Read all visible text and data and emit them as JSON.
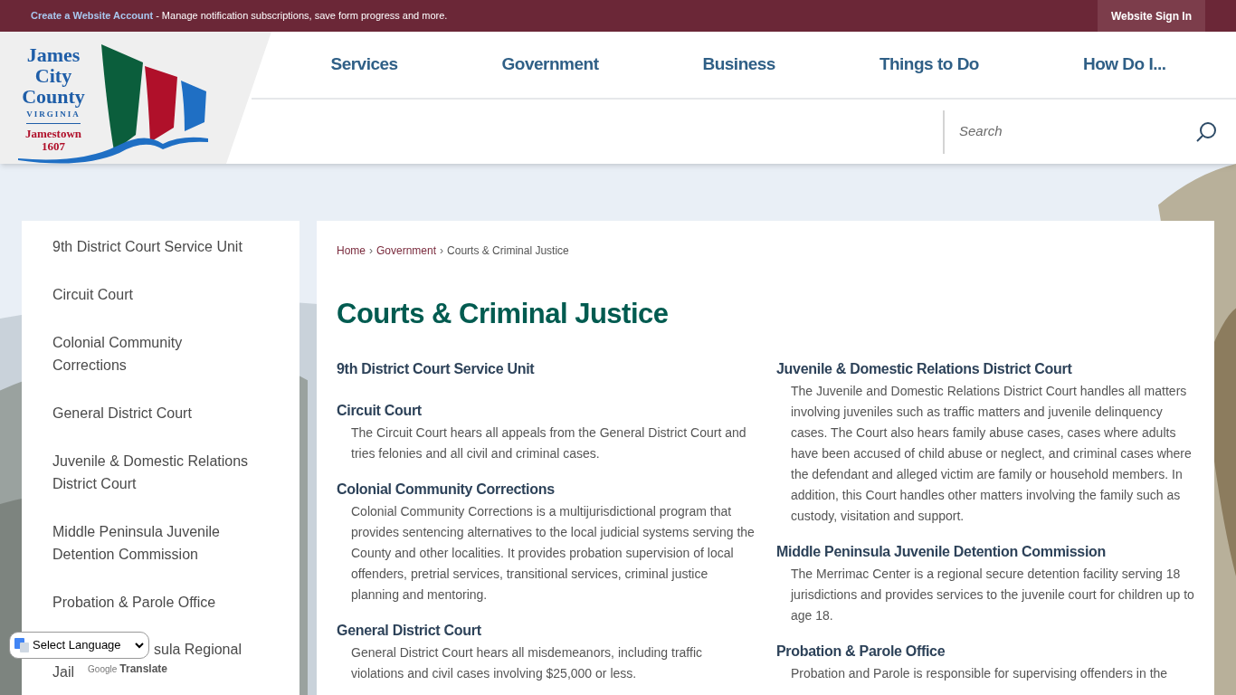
{
  "top_bar": {
    "link": "Create a Website Account",
    "message": " - Manage notification subscriptions, save form progress and more.",
    "sign_in": "Website Sign In"
  },
  "logo": {
    "line_1": "James",
    "line_2": "City",
    "line_3": "County",
    "state": "VIRGINIA",
    "town": "Jamestown",
    "year": "1607"
  },
  "nav": [
    "Services",
    "Government",
    "Business",
    "Things to Do",
    "How Do I..."
  ],
  "search": {
    "placeholder": "Search"
  },
  "sidebar": {
    "items": [
      "9th District Court Service Unit",
      "Circuit Court",
      "Colonial Community Corrections",
      "General District Court",
      "Juvenile & Domestic Relations District Court",
      "Middle Peninsula Juvenile Detention Commission",
      "Probation & Parole Office"
    ],
    "partial_item": {
      "line_1": "sula Regional",
      "line_2": "Jail"
    }
  },
  "breadcrumb": [
    {
      "label": "Home",
      "link": true
    },
    {
      "label": "Government",
      "link": true
    },
    {
      "label": "Courts & Criminal Justice",
      "link": false
    }
  ],
  "separator": "›",
  "title": "Courts & Criminal Justice",
  "columns": [
    [
      {
        "heading": "9th District Court Service Unit"
      },
      {
        "heading": "Circuit Court",
        "text": "The Circuit Court hears all appeals from the General District Court and tries felonies and all civil and criminal cases."
      },
      {
        "heading": "Colonial Community Corrections",
        "text": "Colonial Community Corrections is a multijurisdictional program that provides sentencing alternatives to the local judicial systems serving the County and other localities. It provides probation supervision of local offenders, pretrial services, transitional services, criminal justice planning and mentoring."
      },
      {
        "heading": "General District Court",
        "text": "General District Court hears all misdemeanors, including traffic violations and civil cases involving $25,000 or less."
      }
    ],
    [
      {
        "heading": "Juvenile & Domestic Relations District Court",
        "text": "The Juvenile and Domestic Relations District Court handles all matters involving juveniles such as traffic matters and juvenile delinquency cases. The Court also hears family abuse cases, cases where adults have been accused of child abuse or neglect, and criminal cases where the defendant and alleged victim are family or household members. In addition, this Court handles other matters involving the family such as custody, visitation and support."
      },
      {
        "heading": "Middle Peninsula Juvenile Detention Commission",
        "text": "The Merrimac Center is a regional secure detention facility serving 18 jurisdictions and provides services to the juvenile court for children up to age 18."
      },
      {
        "heading": "Probation & Parole Office",
        "text": "Probation and Parole is responsible for supervising offenders in the"
      }
    ]
  ],
  "translate": {
    "select": "Select Language",
    "brand": "Google",
    "label": "Translate"
  }
}
